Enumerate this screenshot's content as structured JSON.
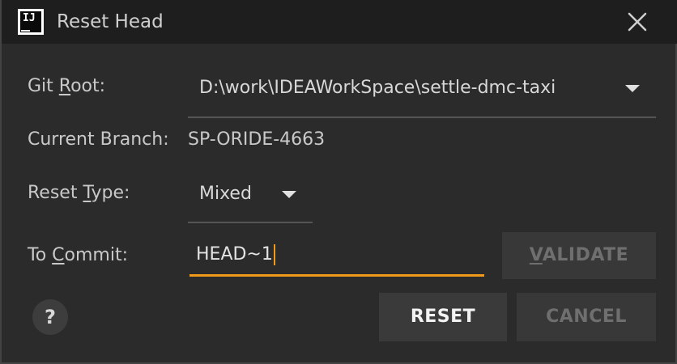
{
  "window": {
    "title": "Reset Head",
    "app_icon": "intellij-idea-icon",
    "app_icon_text": "IJ",
    "close_icon": "close-icon"
  },
  "form": {
    "git_root": {
      "label_pre": "Git ",
      "label_mnemonic": "R",
      "label_post": "oot:",
      "value": "D:\\work\\IDEAWorkSpace\\settle-dmc-taxi",
      "icon": "chevron-down-icon"
    },
    "current_branch": {
      "label": "Current Branch:",
      "value": "SP-ORIDE-4663"
    },
    "reset_type": {
      "label_pre": "Reset ",
      "label_mnemonic": "T",
      "label_post": "ype:",
      "value": "Mixed",
      "icon": "chevron-down-icon"
    },
    "to_commit": {
      "label_pre": "To ",
      "label_mnemonic": "C",
      "label_post": "ommit:",
      "value": "HEAD~1"
    }
  },
  "buttons": {
    "validate_mnemonic": "V",
    "validate_rest": "ALIDATE",
    "reset": "RESET",
    "cancel": "CANCEL",
    "help": "?"
  },
  "colors": {
    "background": "#2b2b2b",
    "titlebar": "#1e1e1e",
    "accent": "#f19a1a",
    "disabled_text": "#6f6f6f"
  }
}
